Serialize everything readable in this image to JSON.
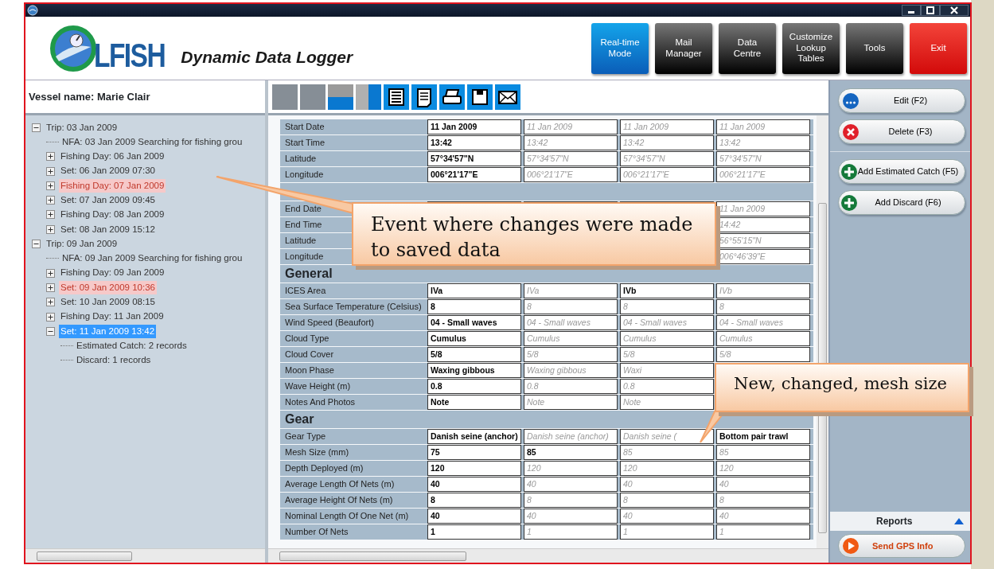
{
  "header": {
    "logo_text": "LFISH",
    "subtitle": "Dynamic Data Logger",
    "buttons": [
      {
        "label": "Real-time\nMode",
        "kind": "mode"
      },
      {
        "label": "Mail\nManager",
        "kind": "normal"
      },
      {
        "label": "Data\nCentre",
        "kind": "normal"
      },
      {
        "label": "Customize\nLookup\nTables",
        "kind": "normal"
      },
      {
        "label": "Tools",
        "kind": "normal"
      },
      {
        "label": "Exit",
        "kind": "exit"
      }
    ]
  },
  "left_panel": {
    "vessel_label": "Vessel name: Marie Clair",
    "tree": [
      {
        "label": "Trip: 03 Jan 2009",
        "expanded": true,
        "changed": false,
        "selected": false,
        "children": [
          {
            "label": "NFA: 03 Jan 2009 Searching for fishing grou",
            "changed": false,
            "selected": false
          },
          {
            "label": "Fishing Day: 06 Jan 2009",
            "expanded": false,
            "changed": false,
            "selected": false
          },
          {
            "label": "Set: 06 Jan 2009 07:30",
            "expanded": false,
            "changed": false,
            "selected": false
          },
          {
            "label": "Fishing Day: 07 Jan 2009",
            "expanded": false,
            "changed": true,
            "selected": false
          },
          {
            "label": "Set: 07 Jan 2009 09:45",
            "expanded": false,
            "changed": false,
            "selected": false
          },
          {
            "label": "Fishing Day: 08 Jan 2009",
            "expanded": false,
            "changed": false,
            "selected": false
          },
          {
            "label": "Set: 08 Jan 2009 15:12",
            "expanded": false,
            "changed": false,
            "selected": false
          }
        ]
      },
      {
        "label": "Trip: 09 Jan 2009",
        "expanded": true,
        "changed": false,
        "selected": false,
        "children": [
          {
            "label": "NFA: 09 Jan 2009 Searching for fishing grou",
            "changed": false,
            "selected": false
          },
          {
            "label": "Fishing Day: 09 Jan 2009",
            "expanded": false,
            "changed": false,
            "selected": false
          },
          {
            "label": "Set: 09 Jan 2009 10:36",
            "expanded": false,
            "changed": true,
            "selected": false
          },
          {
            "label": "Set: 10 Jan 2009 08:15",
            "expanded": false,
            "changed": false,
            "selected": false
          },
          {
            "label": "Fishing Day: 11 Jan 2009",
            "expanded": false,
            "changed": false,
            "selected": false
          },
          {
            "label": "Set: 11 Jan 2009 13:42",
            "expanded": true,
            "changed": false,
            "selected": true,
            "children": [
              {
                "label": "Estimated Catch: 2 records",
                "changed": false,
                "selected": false
              },
              {
                "label": "Discard: 1 records",
                "changed": false,
                "selected": false
              }
            ]
          }
        ]
      }
    ]
  },
  "toolbar": [
    {
      "kind": "tile"
    },
    {
      "kind": "tile"
    },
    {
      "kind": "split-h"
    },
    {
      "kind": "split-v"
    },
    {
      "kind": "document"
    },
    {
      "kind": "notepad"
    },
    {
      "kind": "printer"
    },
    {
      "kind": "floppy"
    },
    {
      "kind": "envelope"
    }
  ],
  "table": {
    "sections": [
      {
        "kind": "plain",
        "rows": [
          {
            "label": "Start Date",
            "cells": [
              {
                "text": "11 Jan 2009",
                "inherited": false
              },
              {
                "text": "11 Jan 2009",
                "inherited": true
              },
              {
                "text": "11 Jan 2009",
                "inherited": true
              },
              {
                "text": "11 Jan 2009",
                "inherited": true
              }
            ]
          },
          {
            "label": "Start Time",
            "cells": [
              {
                "text": "13:42",
                "inherited": false
              },
              {
                "text": "13:42",
                "inherited": true
              },
              {
                "text": "13:42",
                "inherited": true
              },
              {
                "text": "13:42",
                "inherited": true
              }
            ]
          },
          {
            "label": "Latitude",
            "cells": [
              {
                "text": "57°34'57\"N",
                "inherited": false
              },
              {
                "text": "57°34'57\"N",
                "inherited": true
              },
              {
                "text": "57°34'57\"N",
                "inherited": true
              },
              {
                "text": "57°34'57\"N",
                "inherited": true
              }
            ]
          },
          {
            "label": "Longitude",
            "cells": [
              {
                "text": "006°21'17\"E",
                "inherited": false
              },
              {
                "text": "006°21'17\"E",
                "inherited": true
              },
              {
                "text": "006°21'17\"E",
                "inherited": true
              },
              {
                "text": "006°21'17\"E",
                "inherited": true
              }
            ]
          }
        ]
      },
      {
        "kind": "header",
        "rows": [
          {
            "label": "End Date",
            "cells": [
              null,
              null,
              null,
              {
                "text": "11 Jan 2009",
                "inherited": true
              }
            ]
          },
          {
            "label": "End Time",
            "cells": [
              null,
              null,
              null,
              {
                "text": "14:42",
                "inherited": true
              }
            ]
          },
          {
            "label": "Latitude",
            "cells": [
              null,
              null,
              null,
              {
                "text": "56°55'15\"N",
                "inherited": true
              }
            ]
          },
          {
            "label": "Longitude",
            "cells": [
              null,
              null,
              null,
              {
                "text": "006°46'39\"E",
                "inherited": true
              }
            ]
          }
        ]
      },
      {
        "kind": "header",
        "title": "General",
        "rows": [
          {
            "label": "ICES Area",
            "cells": [
              {
                "text": "IVa",
                "inherited": false
              },
              {
                "text": "IVa",
                "inherited": true
              },
              {
                "text": "IVb",
                "inherited": false
              },
              {
                "text": "IVb",
                "inherited": true
              }
            ]
          },
          {
            "label": "Sea Surface Temperature (Celsius)",
            "cells": [
              {
                "text": "8",
                "inherited": false
              },
              {
                "text": "8",
                "inherited": true
              },
              {
                "text": "8",
                "inherited": true
              },
              {
                "text": "8",
                "inherited": true
              }
            ]
          },
          {
            "label": "Wind Speed (Beaufort)",
            "cells": [
              {
                "text": "04 - Small waves",
                "inherited": false
              },
              {
                "text": "04 - Small waves",
                "inherited": true
              },
              {
                "text": "04 - Small waves",
                "inherited": true
              },
              {
                "text": "04 - Small waves",
                "inherited": true
              }
            ]
          },
          {
            "label": "Cloud Type",
            "cells": [
              {
                "text": "Cumulus",
                "inherited": false
              },
              {
                "text": "Cumulus",
                "inherited": true
              },
              {
                "text": "Cumulus",
                "inherited": true
              },
              {
                "text": "Cumulus",
                "inherited": true
              }
            ]
          },
          {
            "label": "Cloud Cover",
            "cells": [
              {
                "text": "5/8",
                "inherited": false
              },
              {
                "text": "5/8",
                "inherited": true
              },
              {
                "text": "5/8",
                "inherited": true
              },
              {
                "text": "5/8",
                "inherited": true
              }
            ]
          },
          {
            "label": "Moon Phase",
            "cells": [
              {
                "text": "Waxing gibbous",
                "inherited": false
              },
              {
                "text": "Waxing gibbous",
                "inherited": true
              },
              {
                "text": "Waxi",
                "inherited": true
              },
              null
            ]
          },
          {
            "label": "Wave Height (m)",
            "cells": [
              {
                "text": "0.8",
                "inherited": false
              },
              {
                "text": "0.8",
                "inherited": true
              },
              {
                "text": "0.8",
                "inherited": true
              },
              null
            ]
          },
          {
            "label": "Notes And Photos",
            "cells": [
              {
                "text": "Note",
                "inherited": false
              },
              {
                "text": "Note",
                "inherited": true
              },
              {
                "text": "Note",
                "inherited": true
              },
              null
            ]
          }
        ]
      },
      {
        "kind": "header",
        "title": "Gear",
        "rows": [
          {
            "label": "Gear Type",
            "cells": [
              {
                "text": "Danish seine (anchor)",
                "inherited": false
              },
              {
                "text": "Danish seine (anchor)",
                "inherited": true
              },
              {
                "text": "Danish seine (",
                "inherited": true
              },
              {
                "text": "Bottom pair trawl",
                "inherited": false
              }
            ]
          },
          {
            "label": "Mesh Size (mm)",
            "cells": [
              {
                "text": "75",
                "inherited": false
              },
              {
                "text": "85",
                "inherited": false
              },
              {
                "text": "85",
                "inherited": true
              },
              {
                "text": "85",
                "inherited": true
              }
            ]
          },
          {
            "label": "Depth Deployed (m)",
            "cells": [
              {
                "text": "120",
                "inherited": false
              },
              {
                "text": "120",
                "inherited": true
              },
              {
                "text": "120",
                "inherited": true
              },
              {
                "text": "120",
                "inherited": true
              }
            ]
          },
          {
            "label": "Average Length Of Nets (m)",
            "cells": [
              {
                "text": "40",
                "inherited": false
              },
              {
                "text": "40",
                "inherited": true
              },
              {
                "text": "40",
                "inherited": true
              },
              {
                "text": "40",
                "inherited": true
              }
            ]
          },
          {
            "label": "Average Height Of Nets (m)",
            "cells": [
              {
                "text": "8",
                "inherited": false
              },
              {
                "text": "8",
                "inherited": true
              },
              {
                "text": "8",
                "inherited": true
              },
              {
                "text": "8",
                "inherited": true
              }
            ]
          },
          {
            "label": "Nominal Length Of One Net (m)",
            "cells": [
              {
                "text": "40",
                "inherited": false
              },
              {
                "text": "40",
                "inherited": true
              },
              {
                "text": "40",
                "inherited": true
              },
              {
                "text": "40",
                "inherited": true
              }
            ]
          },
          {
            "label": "Number Of Nets",
            "cells": [
              {
                "text": "1",
                "inherited": false
              },
              {
                "text": "1",
                "inherited": true
              },
              {
                "text": "1",
                "inherited": true
              },
              {
                "text": "1",
                "inherited": true
              }
            ]
          }
        ]
      }
    ]
  },
  "actions": [
    {
      "label": "Edit (F2)",
      "kind": "edit"
    },
    {
      "label": "Delete (F3)",
      "kind": "delete"
    },
    {
      "label": "Add Estimated Catch (F5)",
      "kind": "add",
      "divider_before": true
    },
    {
      "label": "Add Discard (F6)",
      "kind": "add"
    }
  ],
  "reports": {
    "label": "Reports",
    "send_label": "Send GPS Info"
  },
  "callouts": [
    {
      "text": "Event where changes were made to saved data",
      "kind": "tree"
    },
    {
      "text": "New, changed, mesh size",
      "kind": "table"
    }
  ]
}
